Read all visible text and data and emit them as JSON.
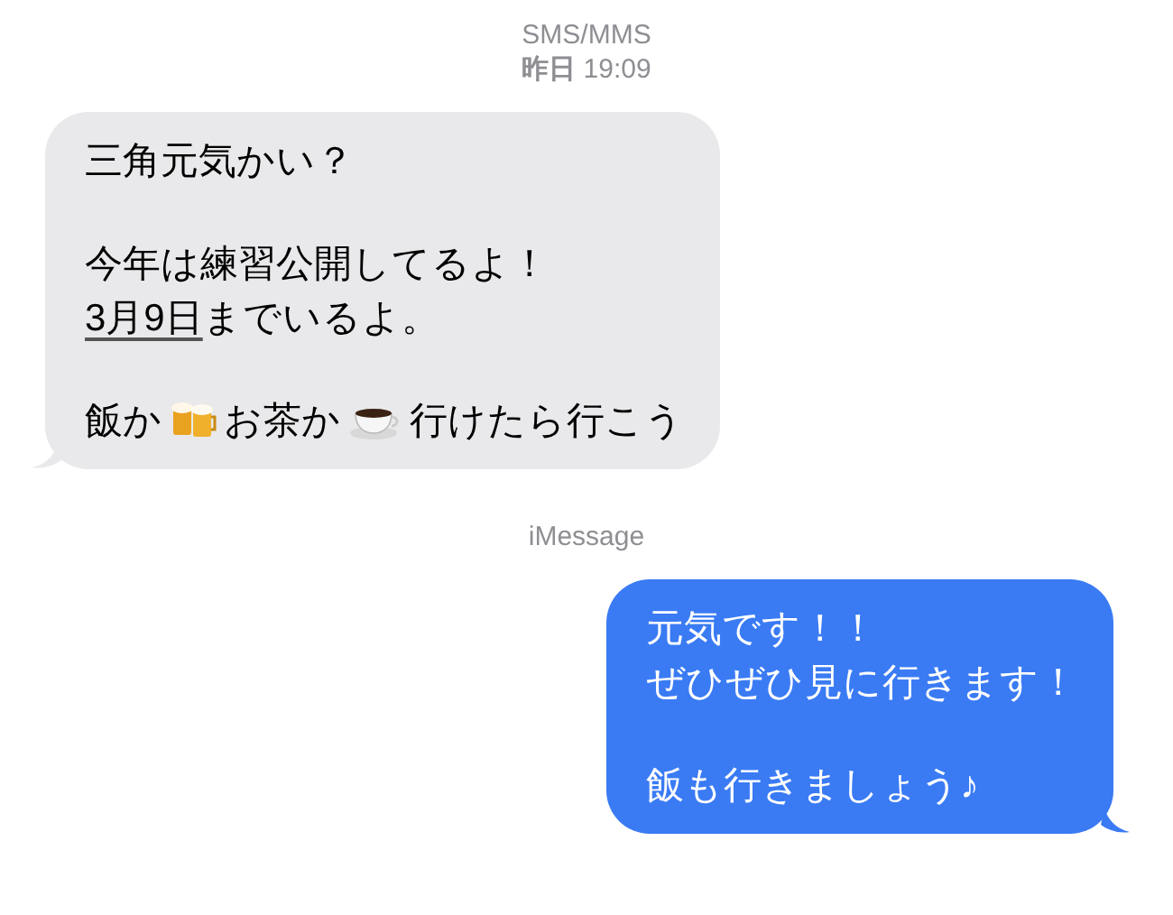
{
  "thread": [
    {
      "kind": "header",
      "lines": [
        "SMS/MMS",
        "**昨日** 19:09"
      ]
    },
    {
      "kind": "incoming",
      "paragraphs": [
        [
          [
            {
              "kind": "text",
              "text": "三角元気かい？"
            }
          ]
        ],
        [
          [
            {
              "kind": "text",
              "text": "今年は練習公開してるよ！"
            }
          ],
          [
            {
              "kind": "link",
              "text": "3月9日"
            },
            {
              "kind": "text",
              "text": "までいるよ。"
            }
          ]
        ],
        [
          [
            {
              "kind": "text",
              "text": "飯か"
            },
            {
              "kind": "emoji"
            },
            {
              "kind": "text",
              "text": "お茶か"
            },
            {
              "kind": "emoji"
            },
            {
              "kind": "text",
              "text": "行けたら行こう"
            }
          ]
        ]
      ]
    },
    {
      "kind": "header",
      "lines": [
        "iMessage"
      ]
    },
    {
      "kind": "outgoing",
      "paragraphs": [
        [
          [
            {
              "kind": "text",
              "text": "元気です！！"
            }
          ],
          [
            {
              "kind": "text",
              "text": "ぜひぜひ見に行きます！"
            }
          ]
        ],
        [
          [
            {
              "kind": "text",
              "text": "飯も行きましょう♪"
            }
          ]
        ]
      ]
    }
  ]
}
